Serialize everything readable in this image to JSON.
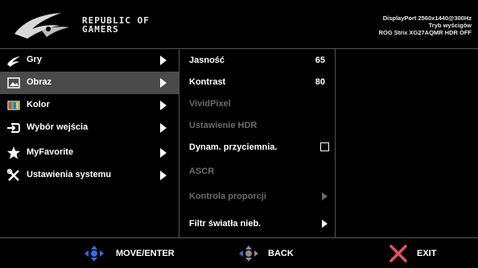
{
  "header": {
    "brand_line1": "REPUBLIC OF",
    "brand_line2": "GAMERS",
    "status_line1": "DisplayPort 2560x1440@300Hz",
    "status_line2": "Tryb wyścigów",
    "status_line3": "ROG Strix XG27AQMR HDR OFF"
  },
  "menu": [
    {
      "label": "Gry",
      "icon": "gaming-icon"
    },
    {
      "label": "Obraz",
      "icon": "image-icon"
    },
    {
      "label": "Kolor",
      "icon": "color-icon"
    },
    {
      "label": "Wybór wejścia",
      "icon": "input-icon"
    },
    {
      "label": "MyFavorite",
      "icon": "star-icon"
    },
    {
      "label": "Ustawienia systemu",
      "icon": "tools-icon"
    }
  ],
  "submenu": [
    {
      "label": "Jasność",
      "value": "65"
    },
    {
      "label": "Kontrast",
      "value": "80"
    },
    {
      "label": "VividPixel"
    },
    {
      "label": "Ustawienie HDR"
    },
    {
      "label": "Dynam. przyciemnia."
    },
    {
      "label": "ASCR"
    },
    {
      "label": "Kontrola proporcji"
    },
    {
      "label": "Filtr światła nieb."
    }
  ],
  "footer": {
    "move_label": "MOVE/ENTER",
    "back_label": "BACK",
    "exit_label": "EXIT"
  },
  "colors": {
    "selected_bg": "#4a4a4a",
    "disabled_text": "#6a6a6a",
    "nav_blue": "#2f6fe0",
    "exit_red": "#e6505c"
  }
}
